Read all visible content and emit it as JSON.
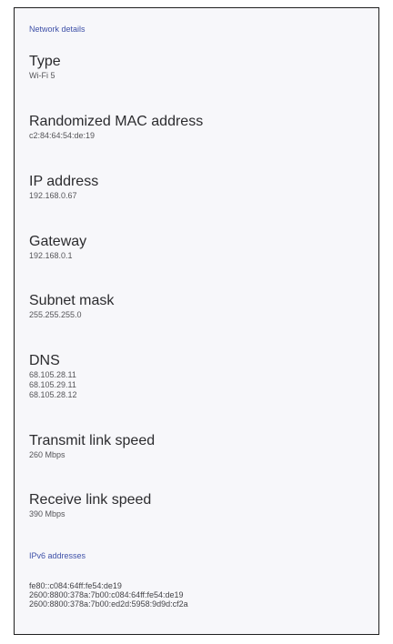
{
  "section_network": "Network details",
  "items": [
    {
      "title": "Type",
      "values": [
        "Wi-Fi 5"
      ]
    },
    {
      "title": "Randomized MAC address",
      "values": [
        "c2:84:64:54:de:19"
      ]
    },
    {
      "title": "IP address",
      "values": [
        "192.168.0.67"
      ]
    },
    {
      "title": "Gateway",
      "values": [
        "192.168.0.1"
      ]
    },
    {
      "title": "Subnet mask",
      "values": [
        "255.255.255.0"
      ]
    },
    {
      "title": "DNS",
      "values": [
        "68.105.28.11",
        "68.105.29.11",
        "68.105.28.12"
      ]
    },
    {
      "title": "Transmit link speed",
      "values": [
        "260 Mbps"
      ]
    },
    {
      "title": "Receive link speed",
      "values": [
        "390 Mbps"
      ]
    }
  ],
  "section_ipv6": "IPv6 addresses",
  "ipv6_addresses": [
    "fe80::c084:64ff:fe54:de19",
    "2600:8800:378a:7b00:c084:64ff:fe54:de19",
    "2600:8800:378a:7b00:ed2d:5958:9d9d:cf2a"
  ]
}
